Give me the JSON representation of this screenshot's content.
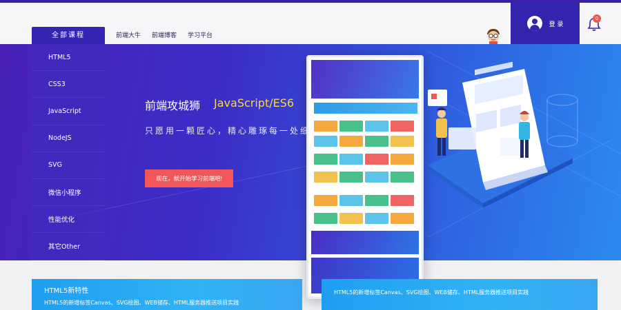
{
  "header": {
    "all_courses": "全部课程",
    "nav": [
      "前端大牛",
      "前端博客",
      "学习平台"
    ],
    "login": "登 录",
    "notification_count": "0"
  },
  "sidebar": {
    "items": [
      {
        "label": "HTML5"
      },
      {
        "label": "CSS3"
      },
      {
        "label": "JavaScript"
      },
      {
        "label": "NodeJS"
      },
      {
        "label": "SVG"
      },
      {
        "label": "微信小程序"
      },
      {
        "label": "性能优化"
      },
      {
        "label": "其它Other"
      }
    ]
  },
  "hero": {
    "title": "前端攻城狮",
    "title_accent": "JavaScript/ES6",
    "subtitle": "只愿用一颗匠心，精心雕琢每一处细节",
    "cta": "现在，就开始学习前端吧!"
  },
  "cards": [
    {
      "title": "HTML5新特性",
      "desc": "HTML5的新增标签Canvas、SVG绘图、WEB储存、HTML服务器推送项目实践"
    },
    {
      "title": "",
      "desc": "HTML5的新增标签Canvas、SVG绘图、WEB储存、HTML服务器推送项目实践"
    }
  ],
  "colors": {
    "accent": "#f5d84a",
    "cta": "#f1565a",
    "brand": "#3424b2",
    "card": "#1f9ef0"
  }
}
